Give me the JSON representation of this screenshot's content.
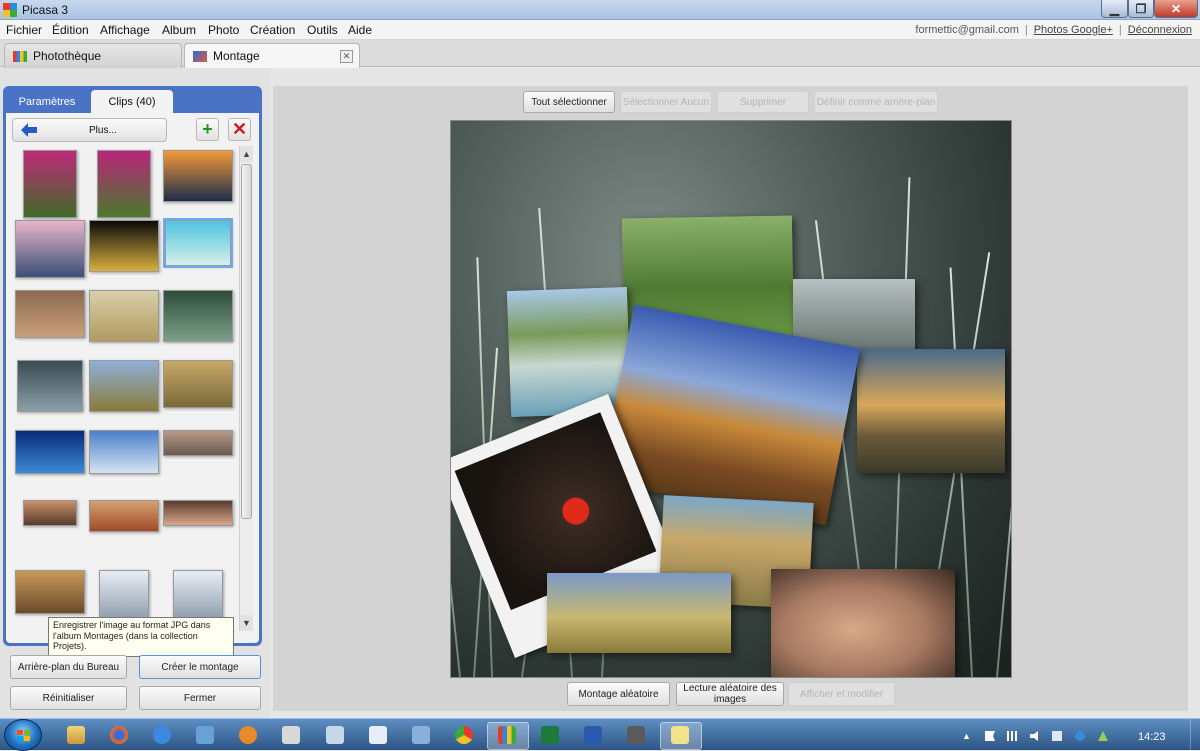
{
  "window": {
    "title": "Picasa 3"
  },
  "menu": [
    "Fichier",
    "Édition",
    "Affichage",
    "Album",
    "Photo",
    "Création",
    "Outils",
    "Aide"
  ],
  "account": {
    "email": "formettic@gmail.com",
    "photos_link": "Photos Google+",
    "logout": "Déconnexion"
  },
  "tabs": {
    "phototheque": "Photothèque",
    "montage": "Montage"
  },
  "panel": {
    "tab_params": "Paramètres",
    "tab_clips": "Clips (40)",
    "back_label": "Plus...",
    "add_icon": "plus-icon",
    "remove_icon": "x-icon"
  },
  "tooltip": "Enregistrer l'image au format JPG dans l'album Montages (dans la collection Projets).",
  "buttons": {
    "desktop_bg": "Arrière-plan du Bureau",
    "create": "Créer le montage",
    "reset": "Réinitialiser",
    "close": "Fermer",
    "select_all": "Tout sélectionner",
    "select_none": "Sélectionner Aucun",
    "delete": "Supprimer",
    "set_bg": "Définir comme arrière-plan",
    "random": "Montage aléatoire",
    "shuffle": "Lecture aléatoire des images",
    "view_edit": "Afficher et modifier"
  },
  "clips": [
    {
      "name": "tulips-1",
      "c1": "#c02a7a",
      "c2": "#3d6a28"
    },
    {
      "name": "tulips-2",
      "c1": "#b8257a",
      "c2": "#4a7a2e"
    },
    {
      "name": "sunset-lake",
      "c1": "#f29a3a",
      "c2": "#1d2c4a"
    },
    {
      "name": "pink-coast",
      "c1": "#e7b5c9",
      "c2": "#3a4f78"
    },
    {
      "name": "gold-swirl",
      "c1": "#0a0a08",
      "c2": "#d8b040"
    },
    {
      "name": "polar-bear-water",
      "c1": "#4fc4e0",
      "c2": "#d6efe8"
    },
    {
      "name": "masai-woman",
      "c1": "#8c6a52",
      "c2": "#c9a07a"
    },
    {
      "name": "cheetah-cubs",
      "c1": "#d8cfaa",
      "c2": "#b29a60"
    },
    {
      "name": "water-lilies",
      "c1": "#2d4d3a",
      "c2": "#7ea08a"
    },
    {
      "name": "lily-pads",
      "c1": "#3a4a52",
      "c2": "#8aa0a8"
    },
    {
      "name": "antelopes",
      "c1": "#8fb0d6",
      "c2": "#8a7a3a"
    },
    {
      "name": "lioness-rest",
      "c1": "#c8a868",
      "c2": "#7a6a3a"
    },
    {
      "name": "blue-fence",
      "c1": "#0a2a7a",
      "c2": "#3a8ad6"
    },
    {
      "name": "dog-sky",
      "c1": "#4a80c8",
      "c2": "#d6e4f2"
    },
    {
      "name": "man-face-1",
      "c1": "#b89a8a",
      "c2": "#6a5a50"
    },
    {
      "name": "boy-face",
      "c1": "#c8906a",
      "c2": "#5a3a2a"
    },
    {
      "name": "woman-face",
      "c1": "#d6a070",
      "c2": "#a04a2a"
    },
    {
      "name": "man-face-2",
      "c1": "#5a3a30",
      "c2": "#d8a888"
    },
    {
      "name": "tortoise-sunset",
      "c1": "#c89a5a",
      "c2": "#6a4a2a"
    },
    {
      "name": "lightbulb-1",
      "c1": "#e8eef4",
      "c2": "#8a9aaa"
    },
    {
      "name": "lightbulb-2",
      "c1": "#e8eef4",
      "c2": "#8a9aaa"
    }
  ],
  "taskbar": {
    "clock": "14:23"
  },
  "colors": {
    "panel_frame": "#4a72c5",
    "canvas_bg": "#2a3430"
  }
}
